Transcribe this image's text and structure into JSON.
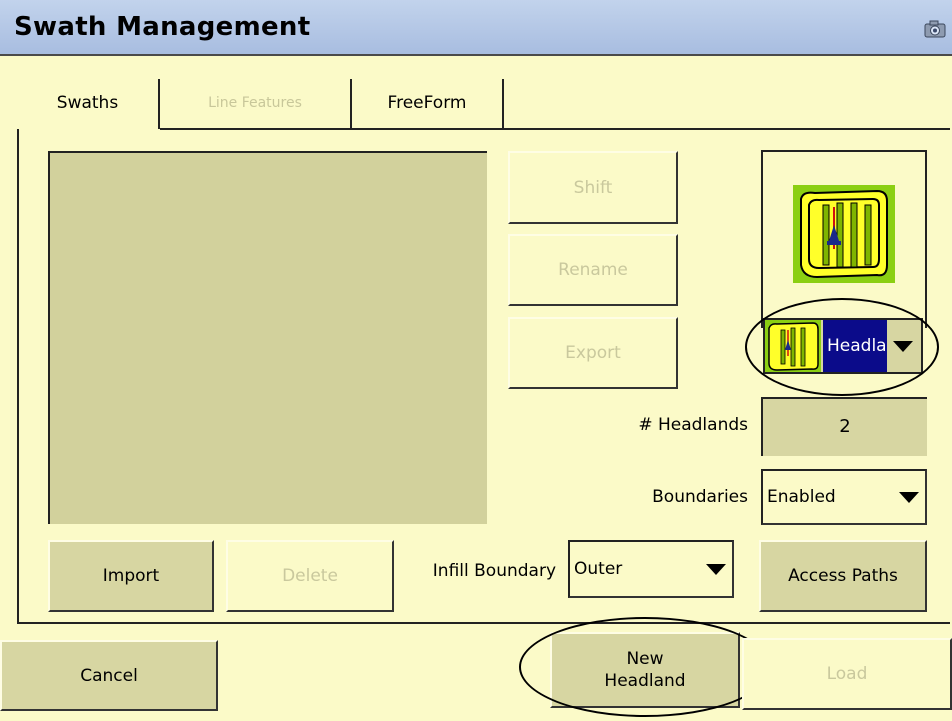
{
  "window": {
    "title": "Swath Management",
    "camera_icon": "camera-icon"
  },
  "tabs": [
    {
      "label": "Swaths",
      "state": "active"
    },
    {
      "label": "Line Features",
      "state": "disabled"
    },
    {
      "label": "FreeForm",
      "state": "normal"
    }
  ],
  "swath_list": {
    "items": []
  },
  "actions": {
    "shift_label": "Shift",
    "rename_label": "Rename",
    "export_label": "Export",
    "import_label": "Import",
    "delete_label": "Delete",
    "access_paths_label": "Access Paths"
  },
  "pattern": {
    "selected": "Headla",
    "icon": "headland-pattern-icon"
  },
  "headlands": {
    "label": "# Headlands",
    "value": "2"
  },
  "boundaries": {
    "label": "Boundaries",
    "value": "Enabled"
  },
  "infill": {
    "label": "Infill Boundary",
    "value": "Outer"
  },
  "footer": {
    "cancel_label": "Cancel",
    "new_headland_label_line1": "New",
    "new_headland_label_line2": "Headland",
    "load_label": "Load"
  },
  "colors": {
    "background": "#fbfac8",
    "button": "#d7d6a2",
    "titlebar": "#b4c8e6",
    "selected_text_bg": "#0b0b8a",
    "field_green": "#8bcf12",
    "field_yellow": "#ffff2a"
  }
}
